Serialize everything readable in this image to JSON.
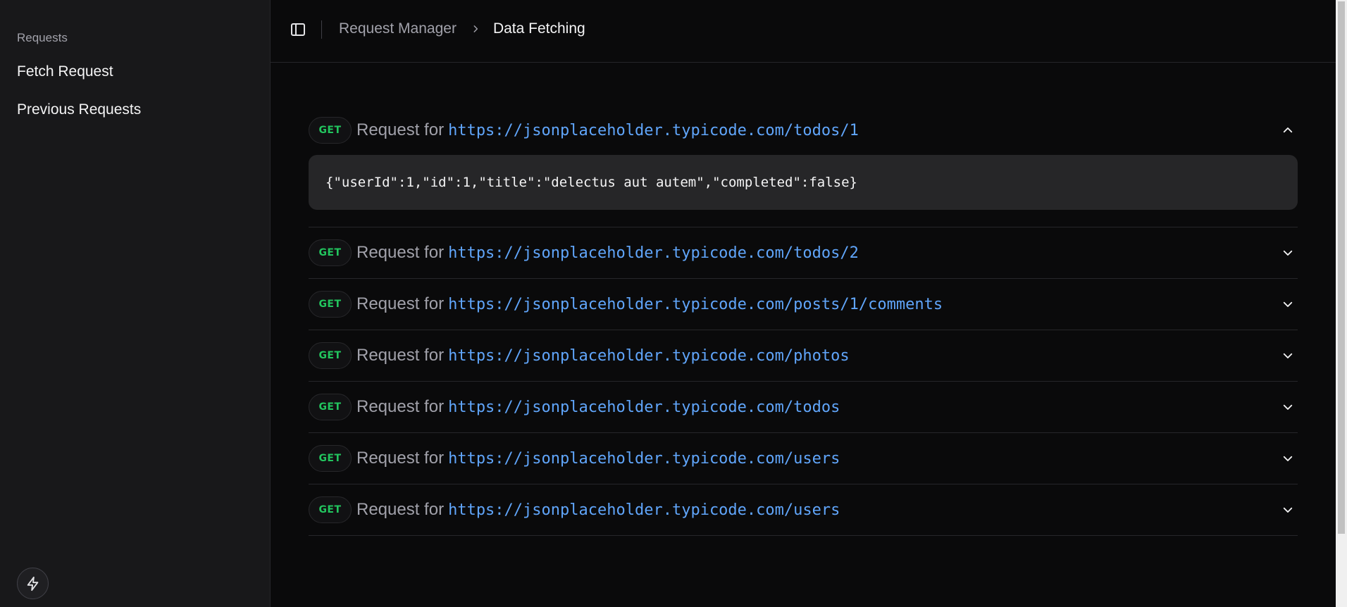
{
  "sidebar": {
    "group_label": "Requests",
    "items": [
      {
        "label": "Fetch Request"
      },
      {
        "label": "Previous Requests"
      }
    ],
    "footer_icon": "lightning-icon"
  },
  "header": {
    "toggle_icon": "sidebar-toggle-icon",
    "breadcrumb": {
      "parent": "Request Manager",
      "current": "Data Fetching"
    }
  },
  "requests": [
    {
      "method": "GET",
      "title": "Request for",
      "url": "https://jsonplaceholder.typicode.com/todos/1",
      "expanded": true,
      "response": "{\"userId\":1,\"id\":1,\"title\":\"delectus aut autem\",\"completed\":false}"
    },
    {
      "method": "GET",
      "title": "Request for",
      "url": "https://jsonplaceholder.typicode.com/todos/2",
      "expanded": false
    },
    {
      "method": "GET",
      "title": "Request for",
      "url": "https://jsonplaceholder.typicode.com/posts/1/comments",
      "expanded": false
    },
    {
      "method": "GET",
      "title": "Request for",
      "url": "https://jsonplaceholder.typicode.com/photos",
      "expanded": false
    },
    {
      "method": "GET",
      "title": "Request for",
      "url": "https://jsonplaceholder.typicode.com/todos",
      "expanded": false
    },
    {
      "method": "GET",
      "title": "Request for",
      "url": "https://jsonplaceholder.typicode.com/users",
      "expanded": false
    },
    {
      "method": "GET",
      "title": "Request for",
      "url": "https://jsonplaceholder.typicode.com/users",
      "expanded": false
    }
  ],
  "colors": {
    "method_get": "#22c55e",
    "url": "#60a5fa",
    "background": "#0a0a0b",
    "sidebar_bg": "#18181a"
  }
}
